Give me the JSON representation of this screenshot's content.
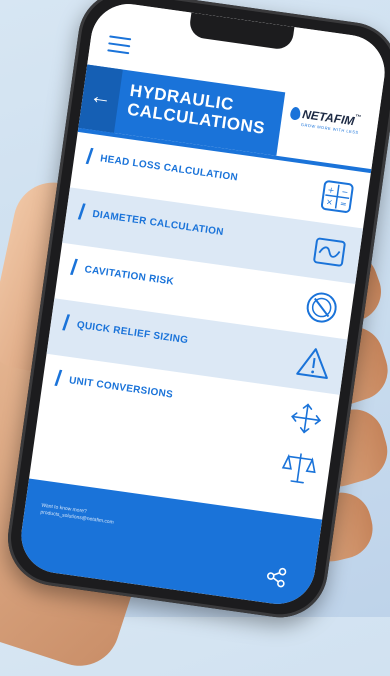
{
  "app": {
    "header": {
      "back_glyph": "←",
      "title_line1": "HYDRAULIC",
      "title_line2": "CALCULATIONS",
      "logo_word": "NETAFIM",
      "logo_tm": "™",
      "logo_tagline": "GROW MORE WITH LESS"
    },
    "menu": [
      {
        "label": "HEAD LOSS CALCULATION",
        "icon": "calculator-icon"
      },
      {
        "label": "DIAMETER CALCULATION",
        "icon": "pipe-diameter-icon"
      },
      {
        "label": "CAVITATION RISK",
        "icon": "cavitation-icon"
      },
      {
        "label": "QUICK RELIEF SIZING",
        "icon": "warning-icon"
      },
      {
        "label": "UNIT CONVERSIONS",
        "icon": "arrows-expand-icon"
      }
    ],
    "extra_icon": "balance-scale-icon",
    "footer": {
      "line1": "Want to know more?",
      "line2": "products_solutions@netafim.com"
    },
    "colors": {
      "brand_blue": "#1a73d9",
      "row_shade": "#dce8f5"
    }
  }
}
